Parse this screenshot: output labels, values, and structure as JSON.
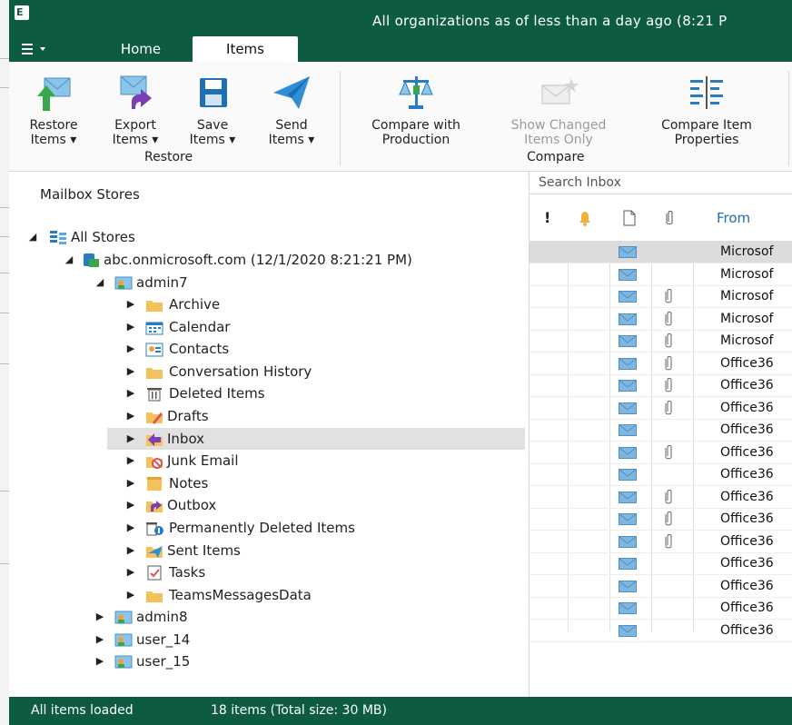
{
  "window": {
    "title": "All organizations as of less than a day ago (8:21 P"
  },
  "tabs": [
    "Home",
    "Items"
  ],
  "ribbon": {
    "restore_group": {
      "label": "Restore",
      "buttons": [
        {
          "label": "Restore\nItems ▾"
        },
        {
          "label": "Export\nItems ▾"
        },
        {
          "label": "Save\nItems ▾"
        },
        {
          "label": "Send\nItems ▾"
        }
      ]
    },
    "compare_group": {
      "label": "Compare",
      "buttons": [
        {
          "label": "Compare with\nProduction",
          "disabled": false
        },
        {
          "label": "Show Changed\nItems Only",
          "disabled": true
        },
        {
          "label": "Compare Item\nProperties",
          "disabled": false
        }
      ]
    }
  },
  "tree": {
    "title": "Mailbox Stores",
    "all_stores": "All Stores",
    "organization": "abc.onmicrosoft.com (12/1/2020 8:21:21 PM)",
    "mailbox": "admin7",
    "folders": [
      "Archive",
      "Calendar",
      "Contacts",
      "Conversation History",
      "Deleted Items",
      "Drafts",
      "Inbox",
      "Junk Email",
      "Notes",
      "Outbox",
      "Permanently Deleted Items",
      "Sent Items",
      "Tasks",
      "TeamsMessagesData"
    ],
    "selected_folder": "Inbox",
    "other_mailboxes": [
      "admin8",
      "user_14",
      "user_15"
    ]
  },
  "list": {
    "search_placeholder": "Search Inbox",
    "from_header": "From",
    "rows": [
      {
        "from": "Microsof",
        "attach": false
      },
      {
        "from": "Microsof",
        "attach": false
      },
      {
        "from": "Microsof",
        "attach": true
      },
      {
        "from": "Microsof",
        "attach": true
      },
      {
        "from": "Microsof",
        "attach": true
      },
      {
        "from": "Office36",
        "attach": true
      },
      {
        "from": "Office36",
        "attach": true
      },
      {
        "from": "Office36",
        "attach": true
      },
      {
        "from": "Office36",
        "attach": false
      },
      {
        "from": "Office36",
        "attach": true
      },
      {
        "from": "Office36",
        "attach": false
      },
      {
        "from": "Office36",
        "attach": true
      },
      {
        "from": "Office36",
        "attach": true
      },
      {
        "from": "Office36",
        "attach": true
      },
      {
        "from": "Office36",
        "attach": false
      },
      {
        "from": "Office36",
        "attach": false
      },
      {
        "from": "Office36",
        "attach": false
      },
      {
        "from": "Office36",
        "attach": false
      }
    ]
  },
  "status": {
    "left": "All items loaded",
    "right": "18 items (Total size: 30 MB)"
  },
  "colors": {
    "brand": "#0d5c41",
    "envelope": "#7fb6e0",
    "folder": "#f5c15a"
  }
}
